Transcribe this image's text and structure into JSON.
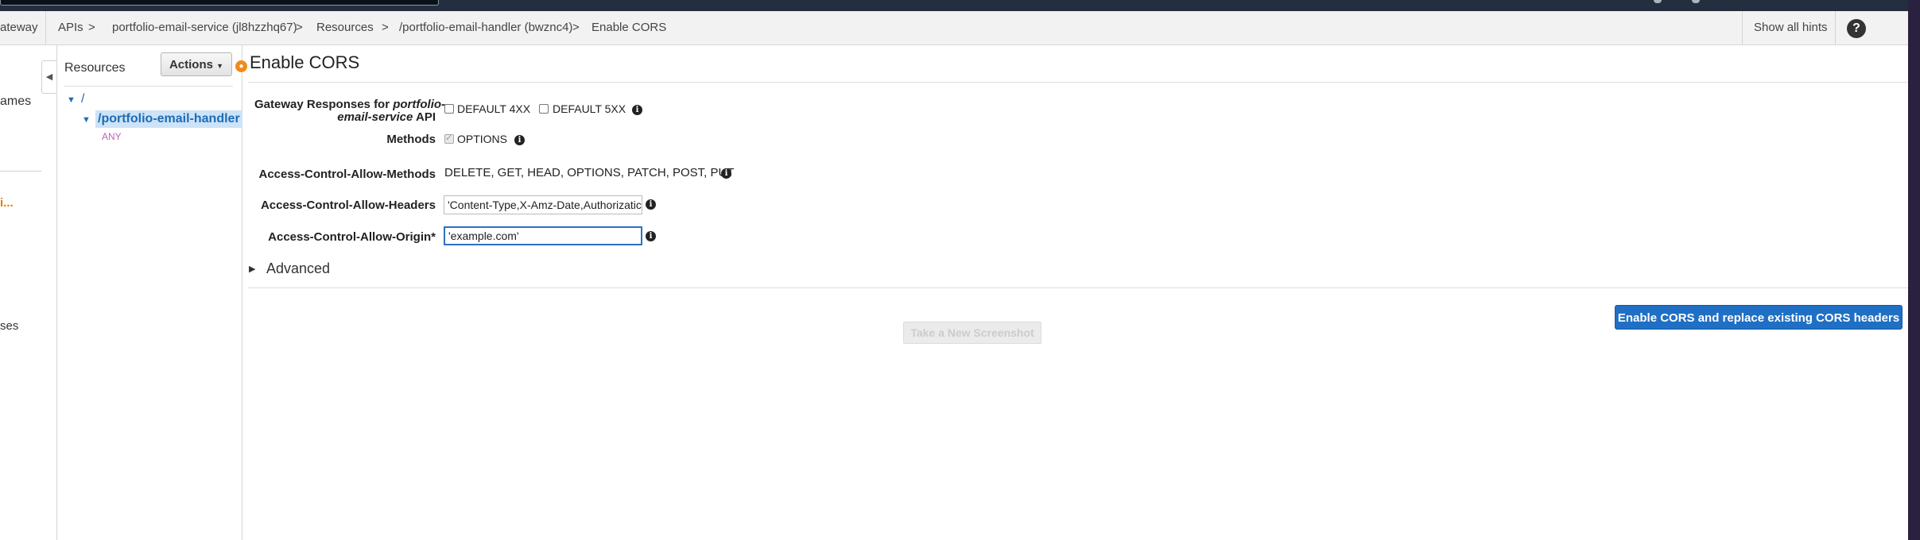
{
  "breadcrumb": {
    "items": [
      "ateway",
      "APIs",
      "portfolio-email-service (jl8hzzhq67)",
      "Resources",
      "/portfolio-email-handler (bwznc4)",
      "Enable CORS"
    ],
    "separator": ">"
  },
  "header": {
    "show_hints": "Show all hints",
    "help": "?"
  },
  "leftnav": {
    "item1": "ames",
    "item2": "i...",
    "item3": "ses"
  },
  "resources": {
    "title": "Resources",
    "actions_label": "Actions",
    "tree_root": "/",
    "tree_selected": "/portfolio-email-handler",
    "tree_method": "ANY"
  },
  "main": {
    "title": "Enable CORS",
    "gateway_label_prefix": "Gateway Responses for ",
    "gateway_label_api": "portfolio-",
    "gateway_label_line2_italic": "email-service",
    "gateway_label_suffix": " API",
    "default_4xx": "DEFAULT 4XX",
    "default_5xx": "DEFAULT 5XX",
    "methods_label": "Methods",
    "methods_option": "OPTIONS",
    "allow_methods_label": "Access-Control-Allow-Methods",
    "allow_methods_value": "DELETE, GET, HEAD, OPTIONS, PATCH, POST, PUT",
    "allow_headers_label": "Access-Control-Allow-Headers",
    "allow_headers_value": "'Content-Type,X-Amz-Date,Authorizatic",
    "allow_origin_label": "Access-Control-Allow-Origin*",
    "allow_origin_value": "'example.com'",
    "advanced_label": "Advanced",
    "screenshot_button": "Take a New Screenshot",
    "submit_button": "Enable CORS and replace existing CORS headers"
  },
  "colors": {
    "primary": "#1f6fc5",
    "topbar": "#232f3e",
    "link": "#1e6bb8",
    "method": "#c063c0"
  }
}
